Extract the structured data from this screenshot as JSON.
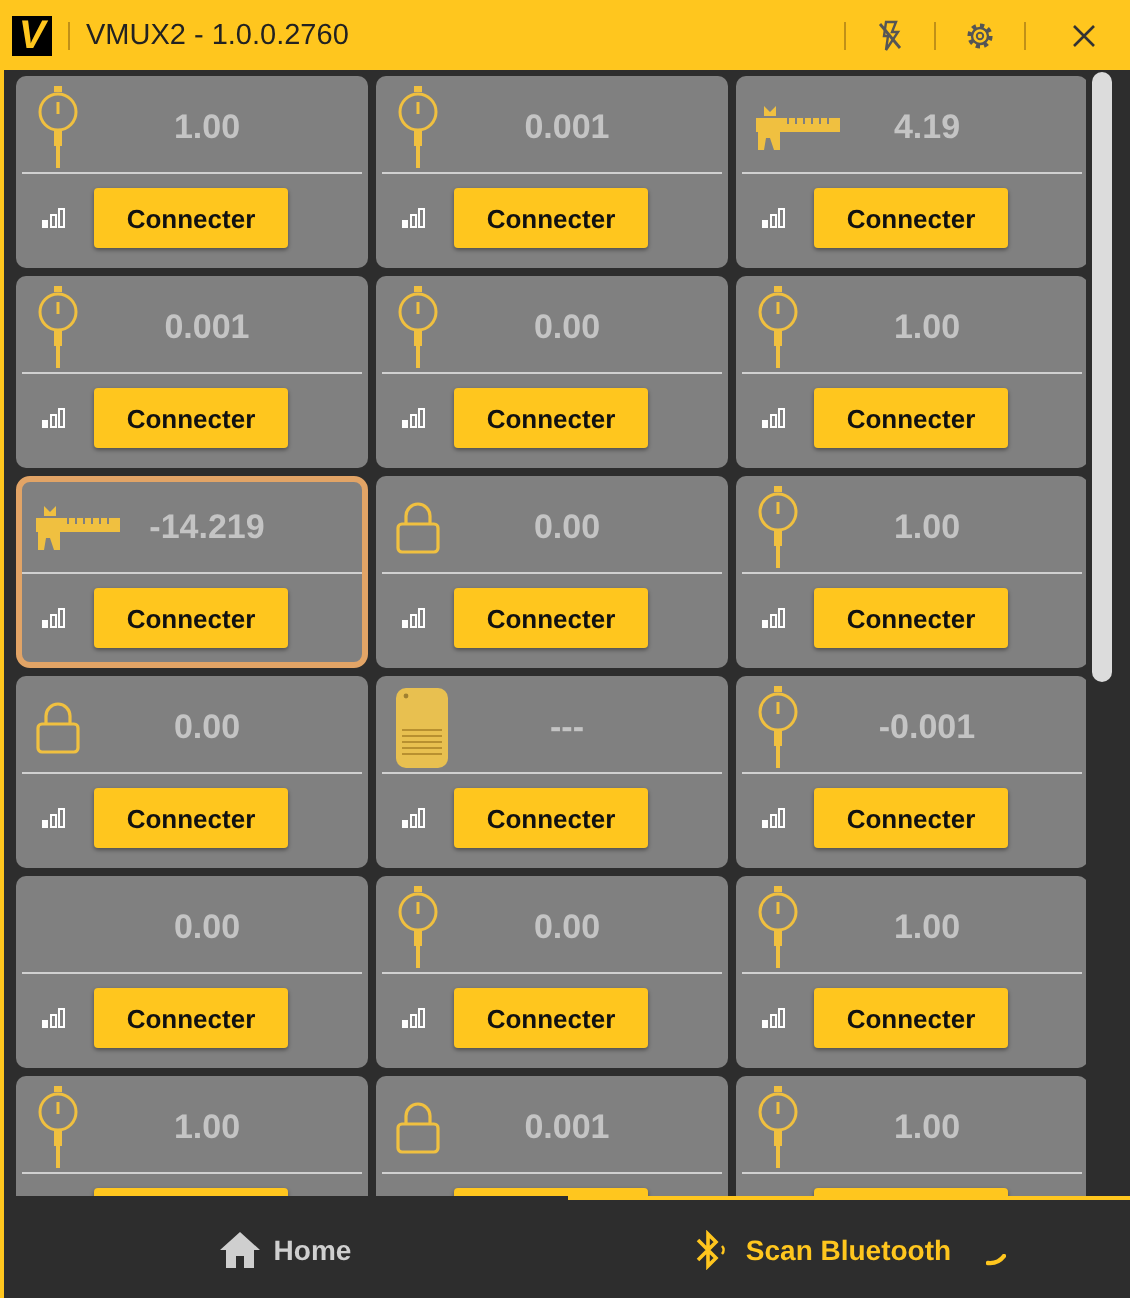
{
  "window": {
    "logo": "V",
    "title": "VMUX2 - 1.0.0.2760"
  },
  "devices": [
    {
      "kind": "dial",
      "value": "1.00",
      "button": "Connecter",
      "selected": false
    },
    {
      "kind": "dial",
      "value": "0.001",
      "button": "Connecter",
      "selected": false
    },
    {
      "kind": "caliper",
      "value": "4.19",
      "button": "Connecter",
      "selected": false
    },
    {
      "kind": "dial",
      "value": "0.001",
      "button": "Connecter",
      "selected": false
    },
    {
      "kind": "dial",
      "value": "0.00",
      "button": "Connecter",
      "selected": false
    },
    {
      "kind": "dial",
      "value": "1.00",
      "button": "Connecter",
      "selected": false
    },
    {
      "kind": "caliper",
      "value": "-14.219",
      "button": "Connecter",
      "selected": true
    },
    {
      "kind": "lock",
      "value": "0.00",
      "button": "Connecter",
      "selected": false
    },
    {
      "kind": "dial",
      "value": "1.00",
      "button": "Connecter",
      "selected": false
    },
    {
      "kind": "lock",
      "value": "0.00",
      "button": "Connecter",
      "selected": false
    },
    {
      "kind": "pad",
      "value": "---",
      "button": "Connecter",
      "selected": false
    },
    {
      "kind": "dial",
      "value": "-0.001",
      "button": "Connecter",
      "selected": false
    },
    {
      "kind": "none",
      "value": "0.00",
      "button": "Connecter",
      "selected": false
    },
    {
      "kind": "dial",
      "value": "0.00",
      "button": "Connecter",
      "selected": false
    },
    {
      "kind": "dial",
      "value": "1.00",
      "button": "Connecter",
      "selected": false
    },
    {
      "kind": "dial",
      "value": "1.00",
      "selected": false
    },
    {
      "kind": "lock",
      "value": "0.001",
      "selected": false
    },
    {
      "kind": "dial",
      "value": "1.00",
      "selected": false
    }
  ],
  "nav": [
    {
      "kind": "home",
      "label": "Home",
      "selected": false
    },
    {
      "kind": "bluetooth",
      "label": "Scan Bluetooth",
      "selected": true,
      "busy": true
    }
  ]
}
